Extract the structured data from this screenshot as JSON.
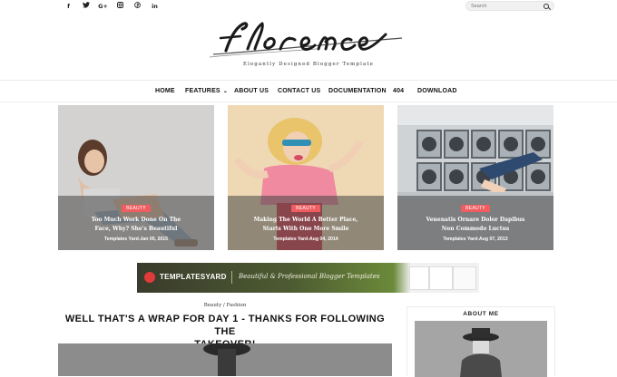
{
  "social": [
    "f",
    "🐦",
    "G+",
    "◎",
    "℗",
    "in"
  ],
  "social_icons": [
    "facebook-icon",
    "twitter-icon",
    "google-plus-icon",
    "instagram-icon",
    "pinterest-icon",
    "linkedin-icon"
  ],
  "search": {
    "placeholder": "Search"
  },
  "site": {
    "tagline": "Elegantly Designed Blogger Template"
  },
  "logo_text": "florence",
  "nav": {
    "home": "HOME",
    "features": "FEATURES",
    "about": "ABOUT US",
    "contact": "CONTACT US",
    "docs": "DOCUMENTATION",
    "notfound": "404",
    "download": "DOWNLOAD"
  },
  "cards": [
    {
      "badge": "BEAUTY",
      "title_line1": "Too Much Work Done On The",
      "title_line2": "Face, Why? She's Beautiful",
      "meta": "Templates Yard-Jan 05, 2015"
    },
    {
      "badge": "BEAUTY",
      "title_line1": "Making The World A Better Place,",
      "title_line2": "Starts With One More Smile",
      "meta": "Templates Yard-Aug 04, 2014"
    },
    {
      "badge": "BEAUTY",
      "title_line1": "Venenatis Ornare Dolor Dapibus",
      "title_line2": "Non Commodo Luctus",
      "meta": "Templates Yard-Aug 07, 2013"
    }
  ],
  "banner": {
    "brand": "TEMPLATESYARD",
    "slogan": "Beautiful & Professional Blogger Templates"
  },
  "post": {
    "categories": "Beauty / Fashion",
    "title_line1": "WELL THAT'S A WRAP FOR DAY 1 - THANKS FOR FOLLOWING THE",
    "title_line2": "TAKEOVER!"
  },
  "sidebar": {
    "about_title": "ABOUT ME"
  },
  "colors": {
    "accent": "#f05d61",
    "text": "#111111",
    "border": "#ececec"
  }
}
